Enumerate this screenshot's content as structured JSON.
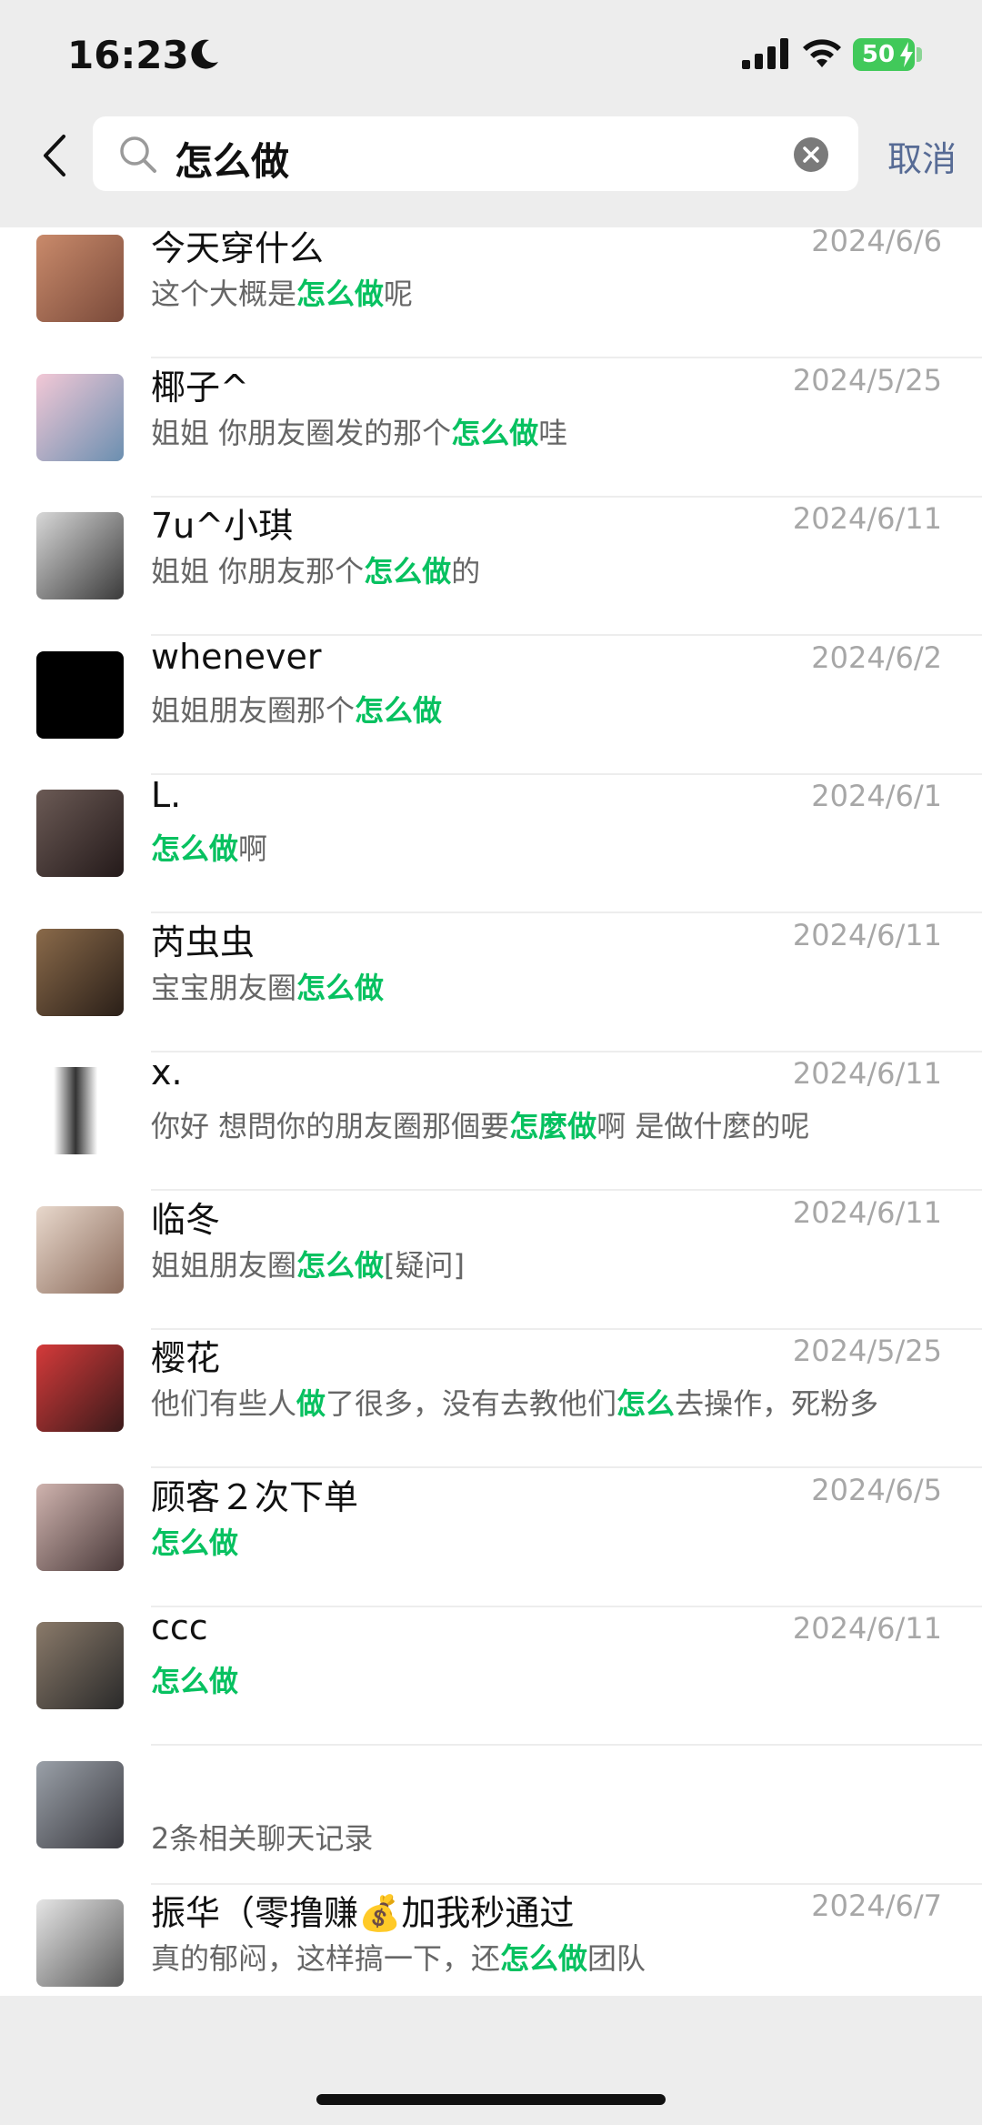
{
  "status_bar": {
    "time": "16:23",
    "battery": "50"
  },
  "search": {
    "query": "怎么做",
    "cancel_label": "取消"
  },
  "results": [
    {
      "name": "今天穿什么",
      "date": "2024/6/6",
      "parts": [
        {
          "t": "这个大概是"
        },
        {
          "t": "怎么做",
          "h": true
        },
        {
          "t": "呢"
        }
      ]
    },
    {
      "name": "椰子^",
      "date": "2024/5/25",
      "parts": [
        {
          "t": "姐姐 你朋友圈发的那个"
        },
        {
          "t": "怎么做",
          "h": true
        },
        {
          "t": "哇"
        }
      ]
    },
    {
      "name": "7u^小琪",
      "date": "2024/6/11",
      "parts": [
        {
          "t": "姐姐 你朋友那个"
        },
        {
          "t": "怎么做",
          "h": true
        },
        {
          "t": "的"
        }
      ]
    },
    {
      "name": "whenever",
      "date": "2024/6/2",
      "parts": [
        {
          "t": "姐姐朋友圈那个"
        },
        {
          "t": "怎么做",
          "h": true
        }
      ]
    },
    {
      "name": "L.",
      "date": "2024/6/1",
      "parts": [
        {
          "t": "怎么做",
          "h": true
        },
        {
          "t": "啊"
        }
      ]
    },
    {
      "name": "芮虫虫",
      "date": "2024/6/11",
      "parts": [
        {
          "t": "宝宝朋友圈"
        },
        {
          "t": "怎么做",
          "h": true
        }
      ]
    },
    {
      "name": "x.",
      "date": "2024/6/11",
      "parts": [
        {
          "t": "你好 想問你的朋友圈那個要"
        },
        {
          "t": "怎麼做",
          "h": true
        },
        {
          "t": "啊 是做什麼的呢"
        }
      ]
    },
    {
      "name": "临冬",
      "date": "2024/6/11",
      "parts": [
        {
          "t": "姐姐朋友圈"
        },
        {
          "t": "怎么做",
          "h": true
        },
        {
          "t": "[疑问]"
        }
      ]
    },
    {
      "name": "樱花",
      "date": "2024/5/25",
      "parts": [
        {
          "t": "他们有些人"
        },
        {
          "t": "做",
          "h": true
        },
        {
          "t": "了很多，没有去教他们"
        },
        {
          "t": "怎么",
          "h": true
        },
        {
          "t": "去操作，死粉多"
        }
      ]
    },
    {
      "name": "顾客２次下单",
      "date": "2024/6/5",
      "parts": [
        {
          "t": "怎么做",
          "h": true
        }
      ]
    },
    {
      "name": "ccc",
      "date": "2024/6/11",
      "parts": [
        {
          "t": "怎么做",
          "h": true
        }
      ]
    },
    {
      "name": "",
      "date": "",
      "parts": [
        {
          "t": "2条相关聊天记录"
        }
      ]
    },
    {
      "name": "振华（零撸赚💰加我秒通过",
      "date": "2024/6/7",
      "parts": [
        {
          "t": "真的郁闷，这样搞一下，还"
        },
        {
          "t": "怎么做",
          "h": true
        },
        {
          "t": "团队"
        }
      ]
    }
  ]
}
